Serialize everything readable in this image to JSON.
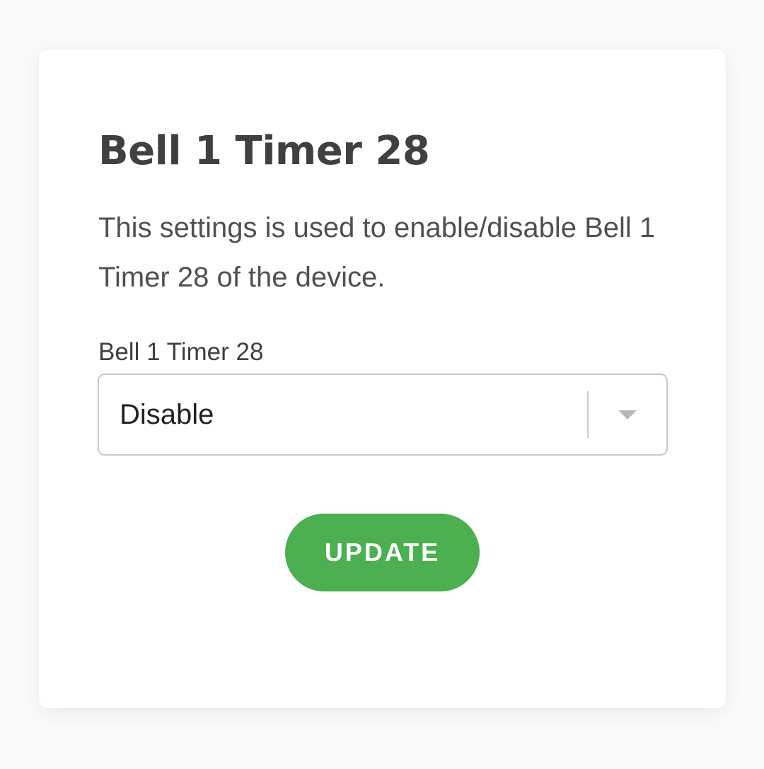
{
  "card": {
    "title": "Bell 1 Timer 28",
    "description": "This settings is used to enable/disable Bell 1 Timer 28 of the device.",
    "field_label": "Bell 1 Timer 28",
    "select": {
      "selected_value": "Disable"
    },
    "update_button_label": "UPDATE"
  },
  "colors": {
    "accent": "#4caf50",
    "text_primary": "#404040",
    "card_background": "#ffffff",
    "page_background": "#fafafa",
    "border": "#c8c8c8"
  },
  "icons": {
    "dropdown": "chevron-down-icon"
  }
}
